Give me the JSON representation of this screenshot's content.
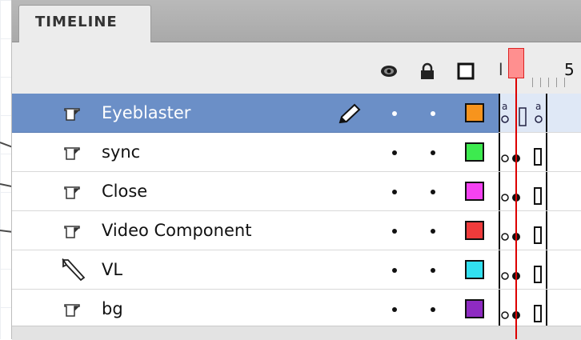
{
  "panel": {
    "tab_label": "TIMELINE",
    "frame_numbers": {
      "first": "l",
      "fifth": "5"
    }
  },
  "header_icons": [
    "eye-icon",
    "lock-icon",
    "outline-icon"
  ],
  "layers": [
    {
      "name": "Eyeblaster",
      "type": "layer",
      "selected": true,
      "color": "#f7941d",
      "pointer": false
    },
    {
      "name": "sync",
      "type": "layer",
      "selected": false,
      "color": "#3dea4f",
      "pointer": true
    },
    {
      "name": "Close",
      "type": "layer",
      "selected": false,
      "color": "#f542f2",
      "pointer": true
    },
    {
      "name": "Video Component",
      "type": "layer",
      "selected": false,
      "color": "#ef3b3b",
      "pointer": true
    },
    {
      "name": "VL",
      "type": "guide",
      "selected": false,
      "color": "#32e0f0",
      "pointer": false
    },
    {
      "name": "bg",
      "type": "layer",
      "selected": false,
      "color": "#8e2bc2",
      "pointer": false
    }
  ]
}
